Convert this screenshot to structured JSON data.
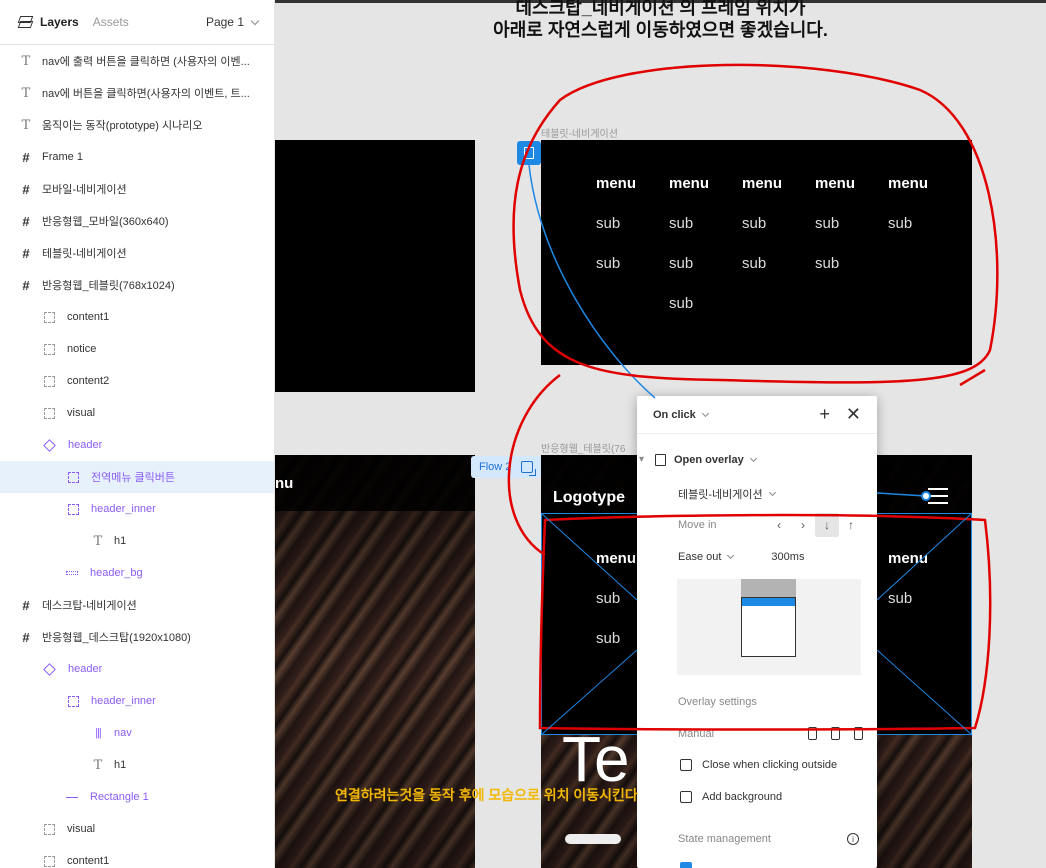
{
  "layers_panel": {
    "tabs": [
      "Layers",
      "Assets"
    ],
    "page_selector": "Page 1",
    "items": [
      {
        "name": "nav에 출력 버튼을 클릭하면 (사용자의 이벤...",
        "type": "text",
        "indent": 0
      },
      {
        "name": "nav에 버튼을 클릭하면(사용자의 이벤트, 트...",
        "type": "text",
        "indent": 0
      },
      {
        "name": "움직이는 동작(prototype) 시나리오",
        "type": "text",
        "indent": 0
      },
      {
        "name": "Frame 1",
        "type": "frame",
        "indent": 0
      },
      {
        "name": "모바일-네비게이션",
        "type": "frame",
        "indent": 0
      },
      {
        "name": "반응형웹_모바일(360x640)",
        "type": "frame",
        "indent": 0
      },
      {
        "name": "테블릿-네비게이션",
        "type": "frame",
        "indent": 0
      },
      {
        "name": "반응형웹_테블릿(768x1024)",
        "type": "frame",
        "indent": 0
      },
      {
        "name": "content1",
        "type": "group",
        "indent": 1
      },
      {
        "name": "notice",
        "type": "group",
        "indent": 1
      },
      {
        "name": "content2",
        "type": "group",
        "indent": 1
      },
      {
        "name": "visual",
        "type": "group",
        "indent": 1
      },
      {
        "name": "header",
        "type": "component",
        "indent": 1
      },
      {
        "name": "전역메뉴 클릭버튼",
        "type": "group",
        "indent": 2,
        "selected": true
      },
      {
        "name": "header_inner",
        "type": "group",
        "indent": 2
      },
      {
        "name": "h1",
        "type": "text",
        "indent": 3
      },
      {
        "name": "header_bg",
        "type": "rect",
        "indent": 2
      },
      {
        "name": "데스크탑-네비게이션",
        "type": "frame",
        "indent": 0
      },
      {
        "name": "반응형웹_데스크탑(1920x1080)",
        "type": "frame",
        "indent": 0
      },
      {
        "name": "header",
        "type": "component",
        "indent": 1
      },
      {
        "name": "header_inner",
        "type": "group",
        "indent": 2
      },
      {
        "name": "nav",
        "type": "nav",
        "indent": 3
      },
      {
        "name": "h1",
        "type": "text",
        "indent": 3
      },
      {
        "name": "Rectangle 1",
        "type": "line",
        "indent": 2
      },
      {
        "name": "visual",
        "type": "group",
        "indent": 1
      },
      {
        "name": "content1",
        "type": "group",
        "indent": 1
      }
    ]
  },
  "canvas": {
    "heading_line1": "데스크탑_네비게이션 의 프레임 위치가",
    "heading_line2": "아래로 자연스럽게 이동하였으면 좋겠습니다.",
    "tablet_nav_label": "테블릿-네비게이션",
    "tablet_frame_label": "반응형웹_테블릿(76",
    "menu_columns": [
      {
        "head": "menu",
        "subs": [
          "sub",
          "sub"
        ]
      },
      {
        "head": "menu",
        "subs": [
          "sub",
          "sub",
          "sub"
        ]
      },
      {
        "head": "menu",
        "subs": [
          "sub",
          "sub"
        ]
      },
      {
        "head": "menu",
        "subs": [
          "sub",
          "sub"
        ]
      },
      {
        "head": "menu",
        "subs": [
          "sub"
        ]
      }
    ],
    "flow_tag": "Flow 2",
    "left_frame_partial_text": "nu",
    "logo": "Logotype",
    "overlay_menu": {
      "left_head": "menu",
      "left_subs": [
        "sub",
        "sub"
      ],
      "right_head": "menu",
      "right_subs": [
        "sub"
      ]
    },
    "hero_text": "Te",
    "annotation": "연결하려는것을 동작 후에 모습으로 위치 이동시킨다"
  },
  "prototype_popup": {
    "trigger": "On click",
    "action": "Open overlay",
    "destination": "테블릿-네비게이션",
    "animation": "Move in",
    "easing": "Ease out",
    "duration": "300ms",
    "overlay_settings_label": "Overlay settings",
    "position": "Manual",
    "close_outside": "Close when clicking outside",
    "add_background": "Add background",
    "state_management": "State management"
  },
  "colors": {
    "accent": "#1e88e5",
    "annotation_red": "#e00000",
    "annotation_yellow": "#f2b705",
    "layer_purple": "#8b5cf6",
    "selection_bg": "#e6f1fc"
  }
}
